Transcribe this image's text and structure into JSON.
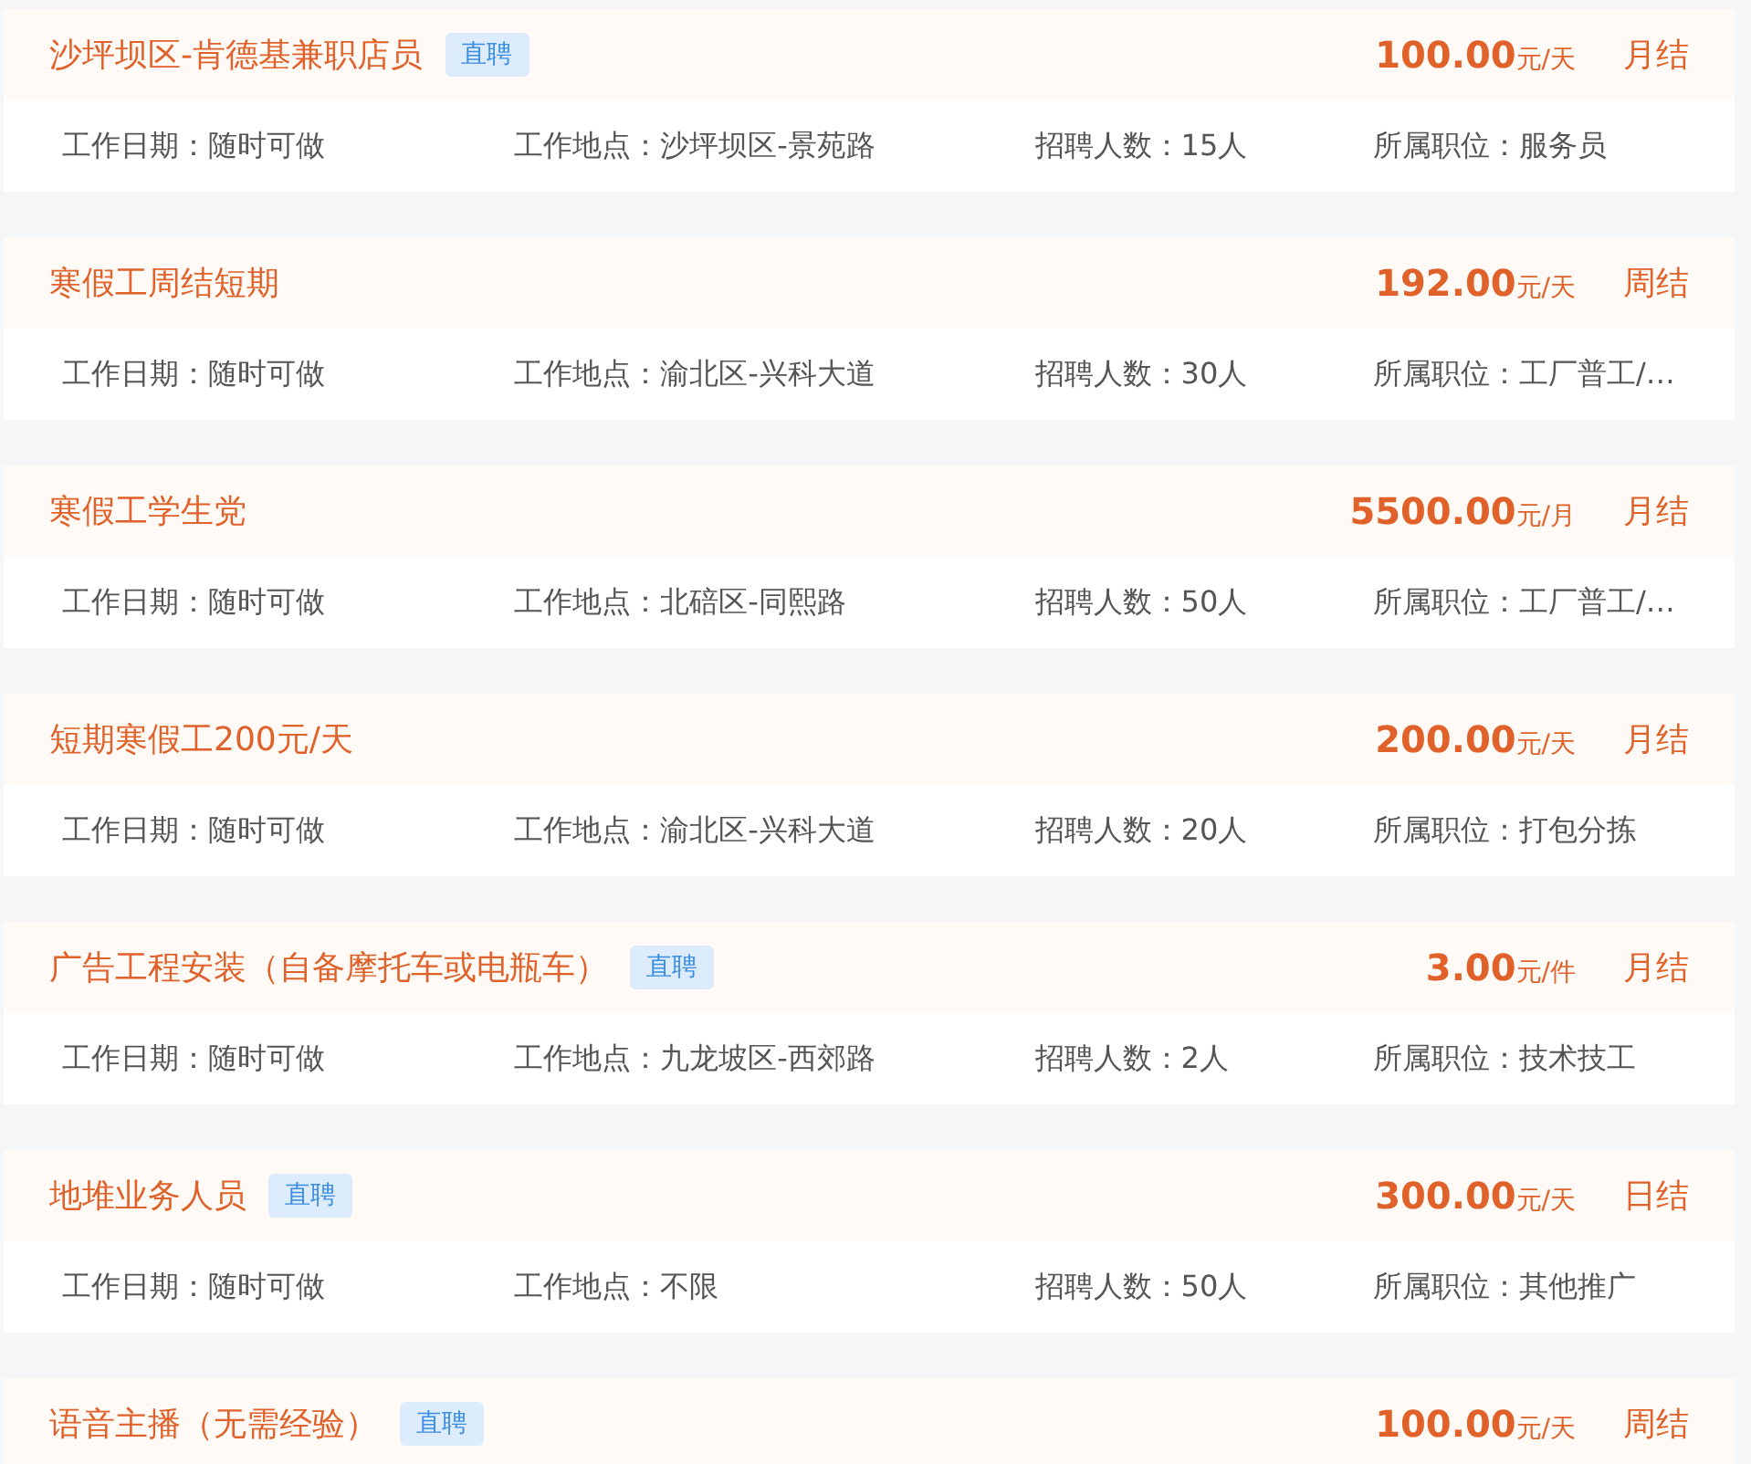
{
  "jobs": [
    {
      "title": "沙坪坝区-肯德基兼职店员",
      "badge": "直聘",
      "amount": "100.00",
      "unit": "元/天",
      "settlement": "月结",
      "details": [
        {
          "label": "工作日期：",
          "value": "随时可做"
        },
        {
          "label": "工作地点：",
          "value": "沙坪坝区-景苑路"
        },
        {
          "label": "招聘人数：",
          "value": "15人"
        },
        {
          "label": "所属职位：",
          "value": "服务员"
        }
      ]
    },
    {
      "title": "寒假工周结短期",
      "amount": "192.00",
      "unit": "元/天",
      "settlement": "周结",
      "details": [
        {
          "label": "工作日期：",
          "value": "随时可做"
        },
        {
          "label": "工作地点：",
          "value": "渝北区-兴科大道"
        },
        {
          "label": "招聘人数：",
          "value": "30人"
        },
        {
          "label": "所属职位：",
          "value": "工厂普工/…"
        }
      ]
    },
    {
      "title": "寒假工学生党",
      "amount": "5500.00",
      "unit": "元/月",
      "settlement": "月结",
      "details": [
        {
          "label": "工作日期：",
          "value": "随时可做"
        },
        {
          "label": "工作地点：",
          "value": "北碚区-同熙路"
        },
        {
          "label": "招聘人数：",
          "value": "50人"
        },
        {
          "label": "所属职位：",
          "value": "工厂普工/…"
        }
      ]
    },
    {
      "title": "短期寒假工200元/天",
      "amount": "200.00",
      "unit": "元/天",
      "settlement": "月结",
      "details": [
        {
          "label": "工作日期：",
          "value": "随时可做"
        },
        {
          "label": "工作地点：",
          "value": "渝北区-兴科大道"
        },
        {
          "label": "招聘人数：",
          "value": "20人"
        },
        {
          "label": "所属职位：",
          "value": "打包分拣"
        }
      ]
    },
    {
      "title": "广告工程安装（自备摩托车或电瓶车）",
      "badge": "直聘",
      "amount": "3.00",
      "unit": "元/件",
      "settlement": "月结",
      "details": [
        {
          "label": "工作日期：",
          "value": "随时可做"
        },
        {
          "label": "工作地点：",
          "value": "九龙坡区-西郊路"
        },
        {
          "label": "招聘人数：",
          "value": "2人"
        },
        {
          "label": "所属职位：",
          "value": "技术技工"
        }
      ]
    },
    {
      "title": "地堆业务人员",
      "badge": "直聘",
      "amount": "300.00",
      "unit": "元/天",
      "settlement": "日结",
      "details": [
        {
          "label": "工作日期：",
          "value": "随时可做"
        },
        {
          "label": "工作地点：",
          "value": "不限"
        },
        {
          "label": "招聘人数：",
          "value": "50人"
        },
        {
          "label": "所属职位：",
          "value": "其他推广"
        }
      ]
    },
    {
      "title": "语音主播（无需经验）",
      "badge": "直聘",
      "amount": "100.00",
      "unit": "元/天",
      "settlement": "周结"
    }
  ]
}
